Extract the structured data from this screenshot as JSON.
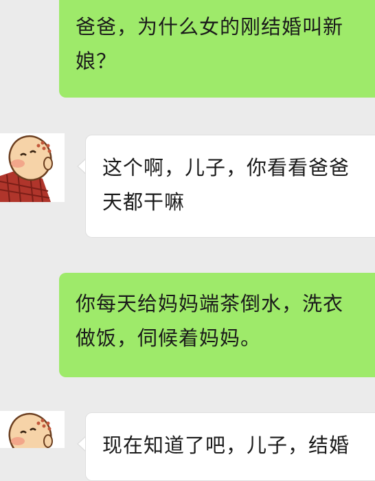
{
  "messages": [
    {
      "direction": "sent",
      "lines": [
        "爸爸，为什么女的刚结婚叫新",
        "娘？"
      ]
    },
    {
      "direction": "received",
      "lines": [
        "这个啊，儿子，你看看爸爸",
        "天都干嘛"
      ]
    },
    {
      "direction": "sent",
      "lines": [
        "你每天给妈妈端茶倒水，洗衣",
        "做饭，伺候着妈妈。"
      ]
    },
    {
      "direction": "received",
      "lines": [
        "现在知道了吧，儿子，结婚"
      ]
    }
  ],
  "avatar_icon": "bald-monk-cartoon-avatar",
  "colors": {
    "background": "#ebebeb",
    "sent_bubble": "#9eea6a",
    "received_bubble": "#ffffff"
  }
}
